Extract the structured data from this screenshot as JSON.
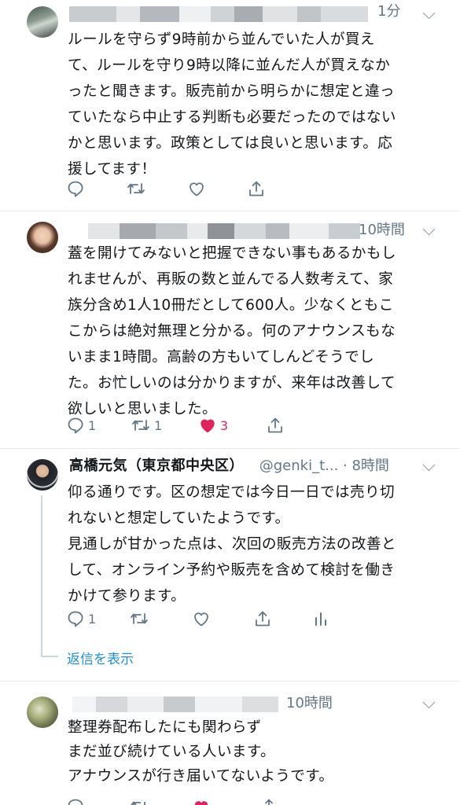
{
  "tweets": [
    {
      "time": "1分",
      "body": [
        "ルールを守らず9時前から並んでいた人が買え",
        "て、ルールを守り9時以降に並んだ人が買えなか",
        "ったと聞きます。販売前から明らかに想定と違っ",
        "ていたなら中止する判断も必要だったのではない",
        "かと思います。政策としては良いと思います。応",
        "援してます！"
      ],
      "reply_count": "",
      "retweet_count": "",
      "like_count": ""
    },
    {
      "time": "10時間",
      "body": [
        "蓋を開けてみないと把握できない事もあるかもし",
        "れませんが、再販の数と並んでる人数考えて、家",
        "族分含め1人10冊だとして600人。少なくともこ",
        "こからは絶対無理と分かる。何のアナウンスもな",
        "いまま1時間。高齢の方もいてしんどそうでし",
        "た。お忙しいのは分かりますが、来年は改善して",
        "欲しいと思いました。"
      ],
      "reply_count": "1",
      "retweet_count": "1",
      "like_count": "3"
    },
    {
      "display_name": "高橋元気（東京都中央区）",
      "handle": "@genki_t...",
      "time": "· 8時間",
      "body": [
        "仰る通りです。区の想定では今日一日では売り切",
        "れないと想定していたようです。",
        "見通しが甘かった点は、次回の販売方法の改善と",
        "して、オンライン予約や販売を含めて検討を働き",
        "かけて参ります。"
      ],
      "reply_count": "1",
      "retweet_count": "",
      "like_count": ""
    },
    {
      "time": "10時間",
      "body": [
        "整理券配布したにも関わらず",
        "まだ並び続けている人います。",
        "アナウンスが行き届いてないようです。"
      ]
    }
  ],
  "show_replies_label": "返信を表示",
  "colors": {
    "accent": "#1d8fd8",
    "like": "#e0245e",
    "muted": "#657786",
    "text": "#14171a"
  }
}
